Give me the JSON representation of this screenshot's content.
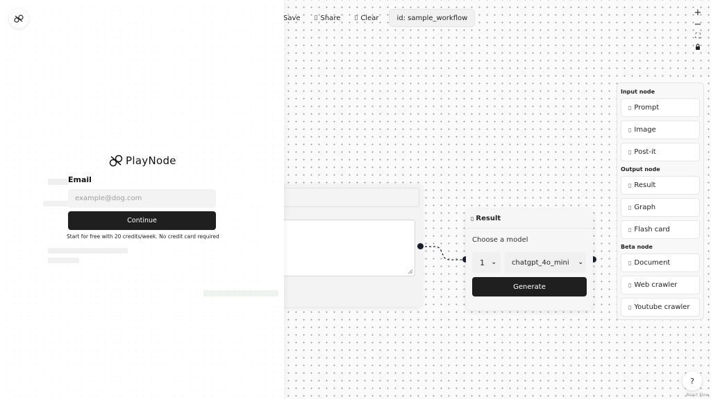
{
  "toolbar": {
    "save_label": "Save",
    "share_label": "Share",
    "clear_label": "Clear",
    "workflow_id": "id: sample_workflow"
  },
  "zoom": {
    "zoom_in": "+",
    "zoom_out": "−",
    "fit_view": "⛶",
    "lock": "🔒"
  },
  "palette": {
    "input_title": "Input node",
    "input_items": [
      {
        "label": "Prompt",
        "icon": "prompt-icon"
      },
      {
        "label": "Image",
        "icon": "image-icon"
      },
      {
        "label": "Post-it",
        "icon": "post-it-icon"
      }
    ],
    "output_title": "Output node",
    "output_items": [
      {
        "label": "Result",
        "icon": "result-icon"
      },
      {
        "label": "Graph",
        "icon": "graph-icon"
      },
      {
        "label": "Flash card",
        "icon": "flash-card-icon"
      }
    ],
    "beta_title": "Beta node",
    "beta_items": [
      {
        "label": "Document",
        "icon": "document-icon"
      },
      {
        "label": "Web crawler",
        "icon": "web-crawler-icon"
      },
      {
        "label": "Youtube crawler",
        "icon": "youtube-crawler-icon"
      }
    ]
  },
  "result_node": {
    "title": "Result",
    "choose_label": "Choose a model",
    "count_value": "1",
    "model_value": "chatgpt_4o_mini",
    "generate_label": "Generate"
  },
  "login": {
    "brand_name": "PlayNode",
    "email_label": "Email",
    "email_placeholder": "example@dog.com",
    "continue_label": "Continue",
    "free_note": "Start for free with 20 credits/week. No credit card required"
  },
  "help": {
    "label": "?"
  },
  "attribution": "React Flow",
  "colors": {
    "primary_dark": "#1f1f1f",
    "handle": "#1a1d2e",
    "canvas": "#fafafa"
  }
}
